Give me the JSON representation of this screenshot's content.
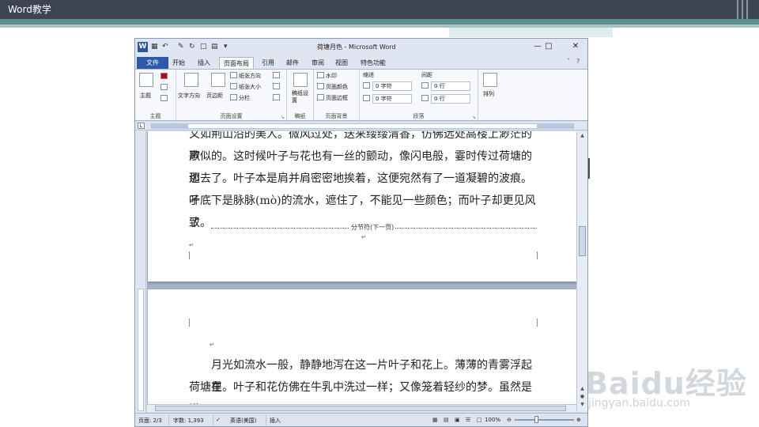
{
  "slide": {
    "title": "Word教学"
  },
  "watermark": {
    "brand": "Baidu经验",
    "url": "jingyan.baidu.com"
  },
  "word": {
    "title": "荷塘月色 - Microsoft Word",
    "tabs": [
      "文件",
      "开始",
      "插入",
      "页面布局",
      "引用",
      "邮件",
      "审阅",
      "视图",
      "特色功能"
    ],
    "active_tab": "页面布局",
    "ribbon": {
      "groups": [
        {
          "label": "主题",
          "items": [
            "主题"
          ]
        },
        {
          "label": "页面设置",
          "items": [
            "文字方向",
            "页边距",
            "纸张方向",
            "纸张大小",
            "分栏"
          ]
        },
        {
          "label": "稿纸",
          "items": [
            "稿纸设置"
          ]
        },
        {
          "label": "页面背景",
          "items": [
            "水印",
            "页面颜色",
            "页面边框"
          ]
        },
        {
          "label": "段落",
          "indent_label": "缩进",
          "spacing_label": "间距",
          "indent_left": "0 字符",
          "indent_right": "0 字符",
          "spacing_before": "0 行",
          "spacing_after": "0 行"
        },
        {
          "label": "",
          "items": [
            "排列"
          ]
        }
      ]
    },
    "page1": {
      "lines": [
        "又如荆山沿的美人。微风过处，送来缕缕清香，仿佛远处高楼上渺茫的歌",
        "声似的。这时候叶子与花也有一丝的颤动，像闪电般，霎时传过荷塘的那",
        "边去了。叶子本是肩并肩密密地挨着，这便宛然有了一道凝碧的波痕。叶",
        "子底下是脉脉(mò)的流水，遮住了，不能见一些颜色；而叶子却更见风致",
        "了。"
      ],
      "section_break": "分节符(下一页)"
    },
    "page2": {
      "lines": [
        "月光如流水一般，静静地泻在这一片叶子和花上。薄薄的青雾浮起在",
        "荷塘里。叶子和花仿佛在牛乳中洗过一样；又像笼着轻纱的梦。虽然是满"
      ]
    },
    "status": {
      "page": "页面: 2/3",
      "words": "字数: 1,393",
      "language": "英语(美国)",
      "mode": "插入",
      "zoom": "100%"
    }
  }
}
